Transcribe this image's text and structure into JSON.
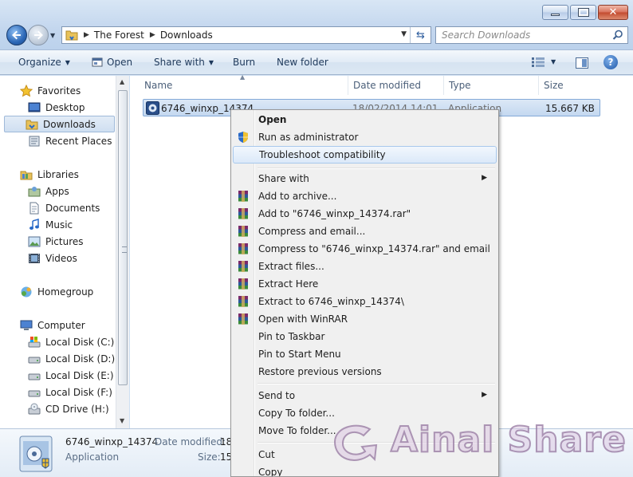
{
  "window": {
    "buttons": {
      "minimize": "minimize",
      "maximize": "maximize",
      "close": "✕"
    }
  },
  "address": {
    "crumbs": [
      "The Forest",
      "Downloads"
    ]
  },
  "search": {
    "placeholder": "Search Downloads"
  },
  "commands": {
    "organize": "Organize",
    "open": "Open",
    "share_with": "Share with",
    "burn": "Burn",
    "new_folder": "New folder",
    "help": "?"
  },
  "nav": {
    "favorites": "Favorites",
    "desktop": "Desktop",
    "downloads": "Downloads",
    "recent_places": "Recent Places",
    "libraries": "Libraries",
    "apps": "Apps",
    "documents": "Documents",
    "music": "Music",
    "pictures": "Pictures",
    "videos": "Videos",
    "homegroup": "Homegroup",
    "computer": "Computer",
    "disk_c": "Local Disk (C:)",
    "disk_d": "Local Disk (D:)",
    "disk_e": "Local Disk (E:)",
    "disk_f": "Local Disk (F:)",
    "cd_drive": "CD Drive (H:)"
  },
  "columns": {
    "name": "Name",
    "date_modified": "Date modified",
    "type": "Type",
    "size": "Size"
  },
  "file": {
    "name": "6746_winxp_14374",
    "date_partial": "18/02/2014 14:01",
    "type_partial": "Application",
    "size": "15.667 KB"
  },
  "details": {
    "name": "6746_winxp_14374",
    "type": "Application",
    "date_label": "Date modified:",
    "date_value": "18",
    "size_label": "Size:",
    "size_value": "15"
  },
  "context_menu": {
    "open": "Open",
    "run_as_admin": "Run as administrator",
    "troubleshoot": "Troubleshoot compatibility",
    "share_with": "Share with",
    "add_to_archive": "Add to archive...",
    "add_to_rar": "Add to \"6746_winxp_14374.rar\"",
    "compress_email": "Compress and email...",
    "compress_rar_email": "Compress to \"6746_winxp_14374.rar\" and email",
    "extract_files": "Extract files...",
    "extract_here": "Extract Here",
    "extract_to": "Extract to 6746_winxp_14374\\",
    "open_winrar": "Open with WinRAR",
    "pin_taskbar": "Pin to Taskbar",
    "pin_start": "Pin to Start Menu",
    "restore_versions": "Restore previous versions",
    "send_to": "Send to",
    "copy_to_folder": "Copy To folder...",
    "move_to_folder": "Move To folder...",
    "cut": "Cut",
    "copy": "Copy"
  },
  "watermark": {
    "text": "Ainal Share"
  }
}
